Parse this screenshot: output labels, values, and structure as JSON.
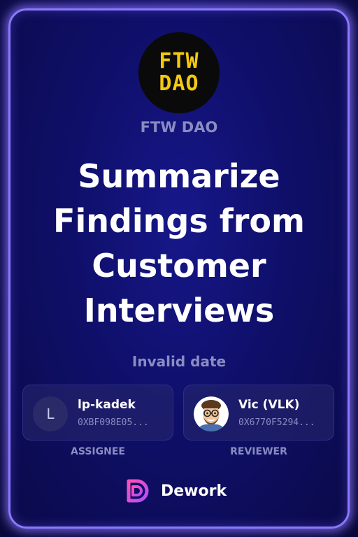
{
  "org": {
    "logo_line1": "FTW",
    "logo_line2": "DAO",
    "name": "FTW DAO"
  },
  "task": {
    "title": "Summarize Findings from Customer Interviews",
    "date": "Invalid date"
  },
  "assignee": {
    "initial": "L",
    "name": "lp-kadek",
    "address": "0XBF098E05...",
    "role_label": "ASSIGNEE"
  },
  "reviewer": {
    "name": "Vic (VLK)",
    "address": "0X6770F5294...",
    "role_label": "REVIEWER",
    "avatar_icon": "bitmoji-avatar"
  },
  "brand": {
    "name": "Dework",
    "icon": "dework-logo-icon"
  },
  "colors": {
    "accent_border": "#8a79ff",
    "logo_yellow": "#f4c911",
    "muted_text": "#8a8cc2",
    "background": "#0f0f6a"
  }
}
